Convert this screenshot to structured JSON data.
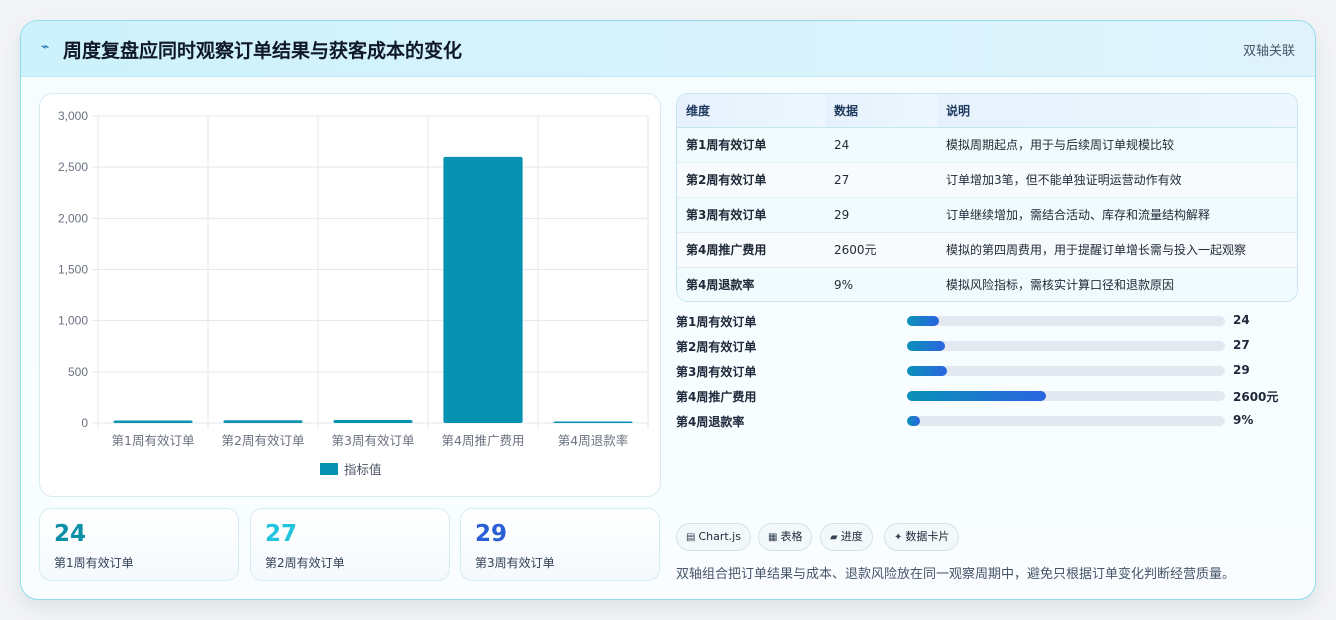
{
  "header": {
    "icon": "pulse-icon",
    "title": "周度复盘应同时观察订单结果与获客成本的变化",
    "tag": "双轴关联"
  },
  "colors": {
    "bar": "#0892b2",
    "kpi1": "#0a8fa6",
    "kpi2": "#22c4dd",
    "kpi3": "#2b5fd6",
    "grid": "#e3e8ee",
    "tick": "#6b7280"
  },
  "chart_data": {
    "type": "bar",
    "categories": [
      "第1周有效订单",
      "第2周有效订单",
      "第3周有效订单",
      "第4周推广费用",
      "第4周退款率"
    ],
    "series": [
      {
        "name": "指标值",
        "values": [
          24,
          27,
          29,
          2600,
          9
        ]
      }
    ],
    "ylim": [
      0,
      3000
    ],
    "yticks": [
      0,
      500,
      1000,
      1500,
      2000,
      2500,
      3000
    ],
    "ytick_labels": [
      "0",
      "500",
      "1,000",
      "1,500",
      "2,000",
      "2,500",
      "3,000"
    ],
    "grid": true,
    "legend": "bottom"
  },
  "kpis": [
    {
      "value": "24",
      "label": "第1周有效订单"
    },
    {
      "value": "27",
      "label": "第2周有效订单"
    },
    {
      "value": "29",
      "label": "第3周有效订单"
    }
  ],
  "table": {
    "headers": [
      "维度",
      "数据",
      "说明"
    ],
    "rows": [
      [
        "第1周有效订单",
        "24",
        "模拟周期起点，用于与后续周订单规模比较"
      ],
      [
        "第2周有效订单",
        "27",
        "订单增加3笔，但不能单独证明运营动作有效"
      ],
      [
        "第3周有效订单",
        "29",
        "订单继续增加，需结合活动、库存和流量结构解释"
      ],
      [
        "第4周推广费用",
        "2600元",
        "模拟的第四周费用，用于提醒订单增长需与投入一起观察"
      ],
      [
        "第4周退款率",
        "9%",
        "模拟风险指标，需核实计算口径和退款原因"
      ]
    ]
  },
  "progress": [
    {
      "label": "第1周有效订单",
      "value": "24",
      "fraction": 0.1
    },
    {
      "label": "第2周有效订单",
      "value": "27",
      "fraction": 0.12
    },
    {
      "label": "第3周有效订单",
      "value": "29",
      "fraction": 0.125
    },
    {
      "label": "第4周推广费用",
      "value": "2600元",
      "fraction": 0.437
    },
    {
      "label": "第4周退款率",
      "value": "9%",
      "fraction": 0.04
    }
  ],
  "chips": [
    {
      "icon": "chart-icon",
      "glyph": "▤",
      "label": "Chart.js"
    },
    {
      "icon": "table-icon",
      "glyph": "▦",
      "label": "表格"
    },
    {
      "icon": "progress-icon",
      "glyph": "▰",
      "label": "进度"
    },
    {
      "icon": "sparkle-icon",
      "glyph": "✦",
      "label": "数据卡片"
    }
  ],
  "footer": {
    "text": "双轴组合把订单结果与成本、退款风险放在同一观察周期中，避免只根据订单变化判断经营质量。"
  }
}
